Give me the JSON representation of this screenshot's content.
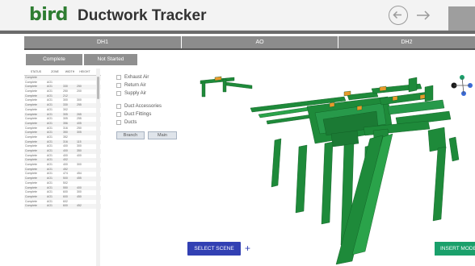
{
  "header": {
    "logo_text": "bird",
    "title": "Ductwork Tracker",
    "back_icon": "arrow-left-circle-icon",
    "forward_icon": "arrow-right-icon"
  },
  "tabs": [
    {
      "label": "DH1"
    },
    {
      "label": "AO"
    },
    {
      "label": "DH2"
    }
  ],
  "status_buttons": {
    "complete": "Complete",
    "not_started": "Not Started"
  },
  "table": {
    "columns": [
      "STATUS",
      "ZONE",
      "WIDTH",
      "HEIGHT"
    ],
    "rows": [
      [
        "Complete",
        "",
        "",
        ""
      ],
      [
        "Complete",
        "AO1",
        "",
        ""
      ],
      [
        "Complete",
        "AO1",
        "330",
        "250"
      ],
      [
        "Complete",
        "AO1",
        "250",
        "200"
      ],
      [
        "Complete",
        "AO1",
        "212",
        ""
      ],
      [
        "Complete",
        "AO1",
        "300",
        "300"
      ],
      [
        "Complete",
        "AO1",
        "330",
        "255"
      ],
      [
        "Complete",
        "AO1",
        "302",
        ""
      ],
      [
        "Complete",
        "AO1",
        "305",
        "265"
      ],
      [
        "Complete",
        "AO1",
        "305",
        "255"
      ],
      [
        "Complete",
        "AO1",
        "356",
        "405"
      ],
      [
        "Complete",
        "AO1",
        "316",
        "250"
      ],
      [
        "Complete",
        "AO1",
        "350",
        "305"
      ],
      [
        "Complete",
        "AO1",
        "352",
        ""
      ],
      [
        "Complete",
        "AO1",
        "316",
        "115"
      ],
      [
        "Complete",
        "AO1",
        "400",
        "300"
      ],
      [
        "Complete",
        "AO1",
        "400",
        "350"
      ],
      [
        "Complete",
        "AO1",
        "400",
        "400"
      ],
      [
        "Complete",
        "AO1",
        "402",
        ""
      ],
      [
        "Complete",
        "AO1",
        "400",
        "300"
      ],
      [
        "Complete",
        "AO1",
        "452",
        ""
      ],
      [
        "Complete",
        "AO1",
        "474",
        "454"
      ],
      [
        "Complete",
        "AO1",
        "500",
        "455"
      ],
      [
        "Complete",
        "AO1",
        "502",
        ""
      ],
      [
        "Complete",
        "AO1",
        "550",
        "400"
      ],
      [
        "Complete",
        "AO1",
        "600",
        "300"
      ],
      [
        "Complete",
        "AO1",
        "600",
        "450"
      ],
      [
        "Complete",
        "AO1",
        "602",
        ""
      ],
      [
        "Complete",
        "AO1",
        "600",
        "452"
      ]
    ]
  },
  "filters": {
    "group1": [
      "Exhaust Air",
      "Return Air",
      "Supply Air"
    ],
    "group2": [
      "Duct Accessories",
      "Duct Fittings",
      "Ducts"
    ]
  },
  "view_buttons": {
    "branch": "Branch",
    "main": "Main"
  },
  "actions": {
    "select_scene": "SELECT SCENE",
    "plus_icon": "plus-icon",
    "insert_mode": "INSERT MODE"
  },
  "colors": {
    "brand_green": "#2e7d32",
    "duct_green": "#1e8a3a",
    "duct_orange": "#e89a2c",
    "accent_blue": "#3240b3",
    "insert_green": "#1aa06b",
    "tab_gray": "#8c8c8c"
  }
}
